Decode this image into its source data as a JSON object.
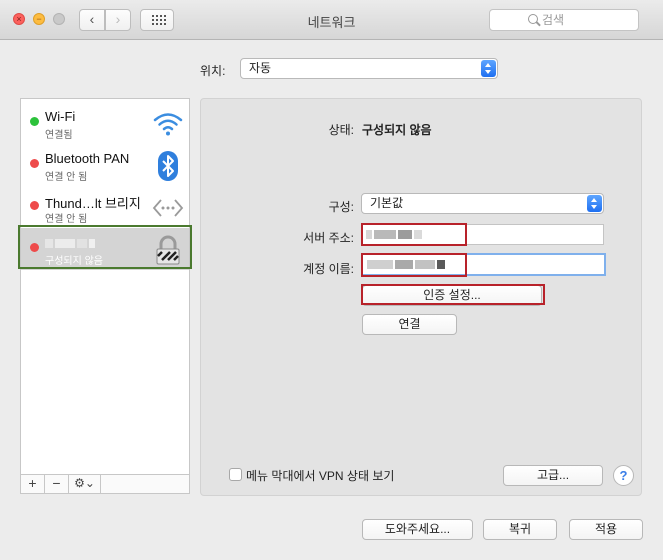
{
  "window": {
    "title": "네트워크"
  },
  "search": {
    "placeholder": "검색"
  },
  "location": {
    "label": "위치:",
    "value": "자동"
  },
  "services": [
    {
      "name": "Wi-Fi",
      "status": "연결됨",
      "status_color": "#2cc23b",
      "icon": "wifi-icon"
    },
    {
      "name": "Bluetooth PAN",
      "status": "연결 안 됨",
      "status_color": "#ee4b4b",
      "icon": "bluetooth-icon"
    },
    {
      "name": "Thund…lt 브리지",
      "status": "연결 안 됨",
      "status_color": "#ee4b4b",
      "icon": "thunderbolt-bridge-icon"
    },
    {
      "name": "",
      "status": "구성되지 않음",
      "status_color": "#ee4b4b",
      "icon": "vpn-lock-icon"
    }
  ],
  "sidebar_tools": {
    "add": "+",
    "remove": "−",
    "gear": "⚙︎⌄"
  },
  "detail": {
    "status_label": "상태:",
    "status_value": "구성되지 않음",
    "config_label": "구성:",
    "config_value": "기본값",
    "server_label": "서버 주소:",
    "server_value": "",
    "account_label": "계정 이름:",
    "account_value": "",
    "auth_button": "인증 설정...",
    "connect_button": "연결",
    "show_vpn_label": "메뉴 막대에서 VPN 상태 보기",
    "advanced_button": "고급...",
    "help_button": "?"
  },
  "footer": {
    "assist_button": "도와주세요...",
    "revert_button": "복귀",
    "apply_button": "적용"
  },
  "colors": {
    "accent": "#1e6ff1",
    "annotation_red": "#b8222a",
    "selection_outline": "#4b7a2f"
  }
}
